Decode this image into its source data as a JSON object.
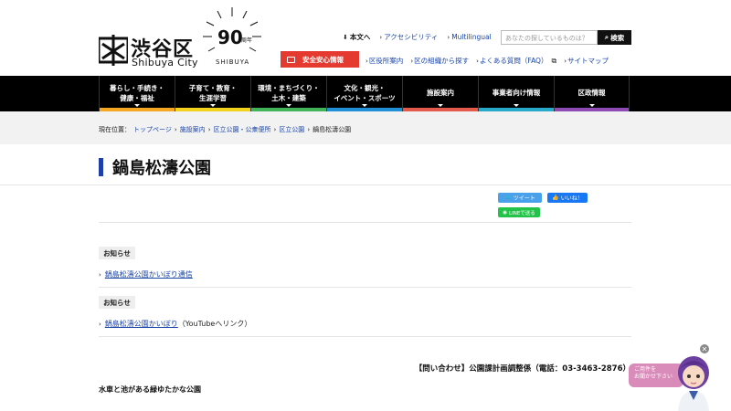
{
  "site": {
    "logo_jp": "渋谷区",
    "logo_en": "Shibuya City",
    "anniv_mark": "90",
    "anniv_sub": "周年",
    "anniv_text": "SHIBUYA"
  },
  "util_nav": {
    "main_text": "本文へ",
    "accessibility": "アクセシビリティ",
    "multilingual": "Multilingual"
  },
  "search": {
    "placeholder": "あなたの探しているものは？",
    "button": "検索"
  },
  "safety": {
    "label": "安全安心情報"
  },
  "sub_nav": {
    "offices": "区役所案内",
    "organization": "区の組織から探す",
    "faq": "よくある質問（FAQ）",
    "sitemap": "サイトマップ"
  },
  "gnav": [
    {
      "label": "暮らし・手続き・\n健康・福祉",
      "color": "#f5a623"
    },
    {
      "label": "子育て・教育・\n生涯学習",
      "color": "#f2d21f"
    },
    {
      "label": "環境・まちづくり・\n土木・建築",
      "color": "#43b35a"
    },
    {
      "label": "文化・観光・\nイベント・スポーツ",
      "color": "#1f8fd6"
    },
    {
      "label": "施設案内",
      "color": "#e35a4a"
    },
    {
      "label": "事業者向け情報",
      "color": "#27a9c9"
    },
    {
      "label": "区政情報",
      "color": "#8e4bb3"
    }
  ],
  "breadcrumb": {
    "prefix": "現在位置：",
    "items": [
      "トップページ",
      "施設案内",
      "区立公園・公衆便所",
      "区立公園"
    ],
    "current": "鍋島松濤公園"
  },
  "page": {
    "title": "鍋島松濤公園"
  },
  "sns": {
    "tweet": "ツイート",
    "like": "いいね！",
    "line": "LINEで送る"
  },
  "notices": [
    {
      "label": "お知らせ",
      "link": "鍋島松濤公園かいぼり通信",
      "suffix": ""
    },
    {
      "label": "お知らせ",
      "link": "鍋島松濤公園かいぼり",
      "suffix": "（YouTubeへリンク）"
    }
  ],
  "contact": "【問い合わせ】公園課計画調整係（電話：03-3463-2876）",
  "description": "水車と池がある緑ゆたかな公園",
  "chat": {
    "line1": "ご用件を",
    "line2": "お聞かせ下さい"
  }
}
